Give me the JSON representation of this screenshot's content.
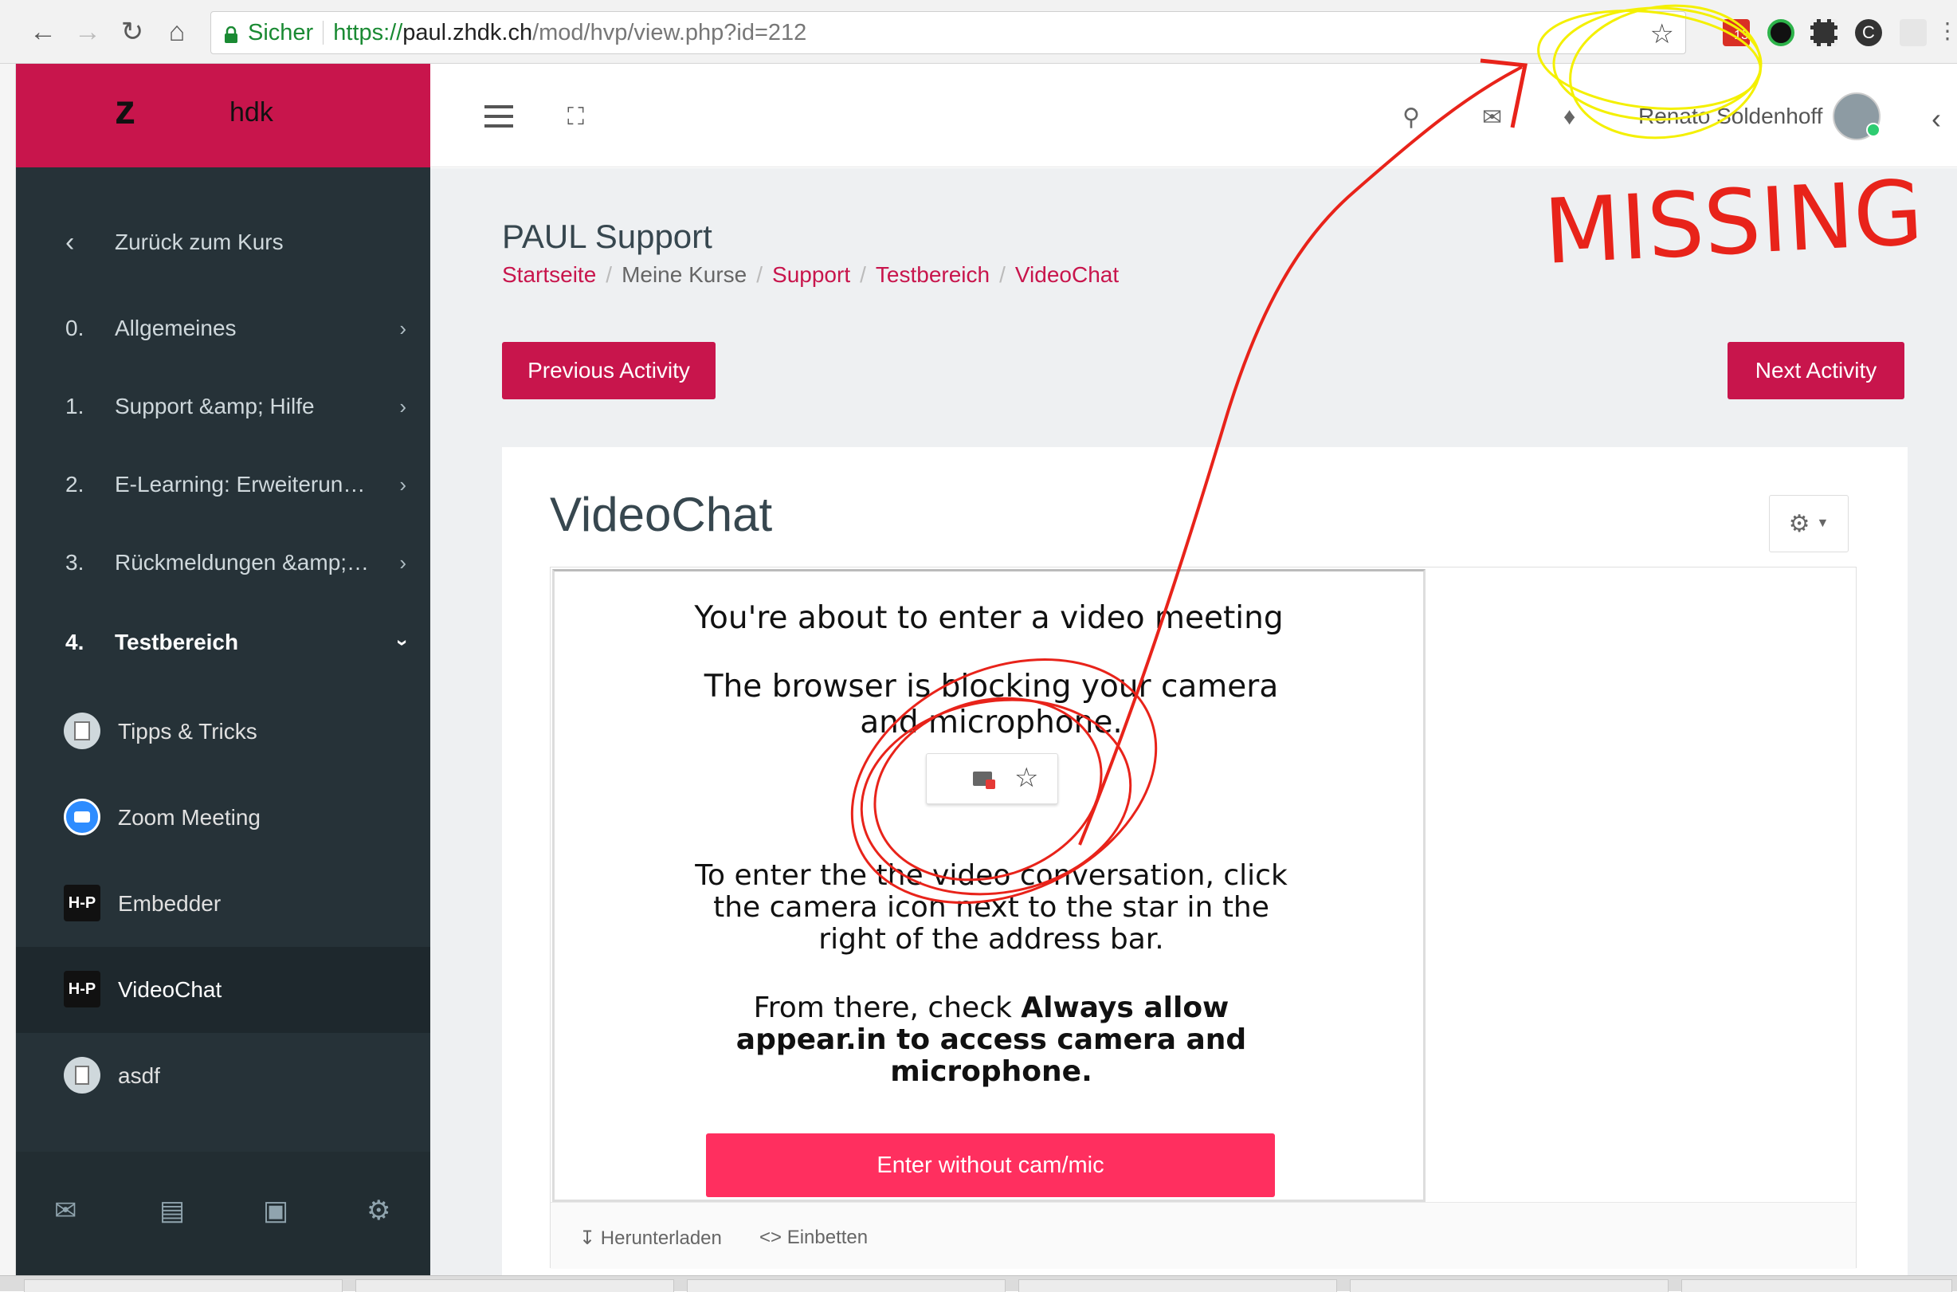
{
  "browser": {
    "secure_label": "Sicher",
    "url_scheme": "https://",
    "url_host": "paul.zhdk.ch",
    "url_path": "/mod/hvp/view.php?id=212",
    "calendar_badge": "13",
    "profile_letter": "C"
  },
  "brand": {
    "logo_letter": "z",
    "logo_text": "hdk",
    "accent": "#c8154c"
  },
  "sidebar": {
    "back_label": "Zurück zum Kurs",
    "sections": [
      {
        "num": "0.",
        "label": "Allgemeines"
      },
      {
        "num": "1.",
        "label": "Support &amp; Hilfe"
      },
      {
        "num": "2.",
        "label": "E-Learning: Erweiterun…"
      },
      {
        "num": "3.",
        "label": "Rückmeldungen &amp;…"
      },
      {
        "num": "4.",
        "label": "Testbereich"
      }
    ],
    "activities": [
      {
        "icon": "book-icon",
        "label": "Tipps & Tricks"
      },
      {
        "icon": "zoom-icon",
        "label": "Zoom Meeting"
      },
      {
        "icon": "h5p-icon",
        "icon_text": "H-P",
        "label": "Embedder"
      },
      {
        "icon": "h5p-icon",
        "icon_text": "H-P",
        "label": "VideoChat"
      },
      {
        "icon": "file-icon",
        "label": "asdf"
      }
    ]
  },
  "header": {
    "user_name": "Renato Soldenhoff"
  },
  "page": {
    "course_title": "PAUL Support",
    "breadcrumbs": [
      "Startseite",
      "Meine Kurse",
      "Support",
      "Testbereich",
      "VideoChat"
    ],
    "prev_button": "Previous Activity",
    "next_button": "Next Activity",
    "activity_title": "VideoChat"
  },
  "h5p": {
    "heading": "You're about to enter a video meeting",
    "blocked_text": "The browser is blocking your camera and microphone.",
    "instructions": "To enter the the video conversation, click the camera icon next to the star in the right of the address bar.",
    "check_prefix": "From there, check ",
    "check_bold": "Always allow appear.in to access camera and microphone.",
    "enter_button": "Enter without cam/mic",
    "download_label": "Herunterladen",
    "embed_label": "Einbetten"
  },
  "annotation": {
    "text": "MISSING",
    "colors": {
      "arrow": "#e8231a",
      "circle_yellow": "#f4f000"
    }
  }
}
